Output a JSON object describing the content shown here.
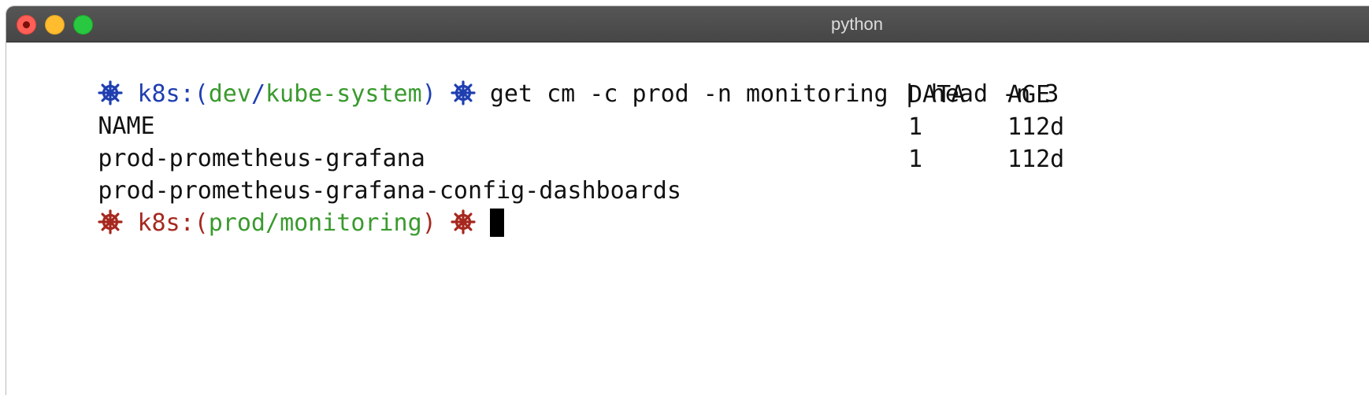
{
  "window": {
    "title": "python"
  },
  "colors": {
    "prompt_dev": "#1f3fb0",
    "prompt_prod": "#a6281f",
    "context_green": "#3a9a2e",
    "text": "#111111"
  },
  "terminal": {
    "line1": {
      "icon": "kubernetes-helm-icon",
      "prompt_prefix": "k8s:(",
      "cluster": "dev",
      "slash": "/",
      "namespace": "kube-system",
      "prompt_suffix": ")",
      "command": "get cm -c prod -n monitoring | head -n 3"
    },
    "table": {
      "headers": [
        "NAME",
        "DATA",
        "AGE"
      ],
      "rows": [
        [
          "prod-prometheus-grafana",
          "1",
          "112d"
        ],
        [
          "prod-prometheus-grafana-config-dashboards",
          "1",
          "112d"
        ]
      ]
    },
    "line5": {
      "icon": "kubernetes-helm-icon",
      "prompt_prefix": "k8s:(",
      "cluster": "prod",
      "slash": "/",
      "namespace": "monitoring",
      "prompt_suffix": ")"
    }
  }
}
